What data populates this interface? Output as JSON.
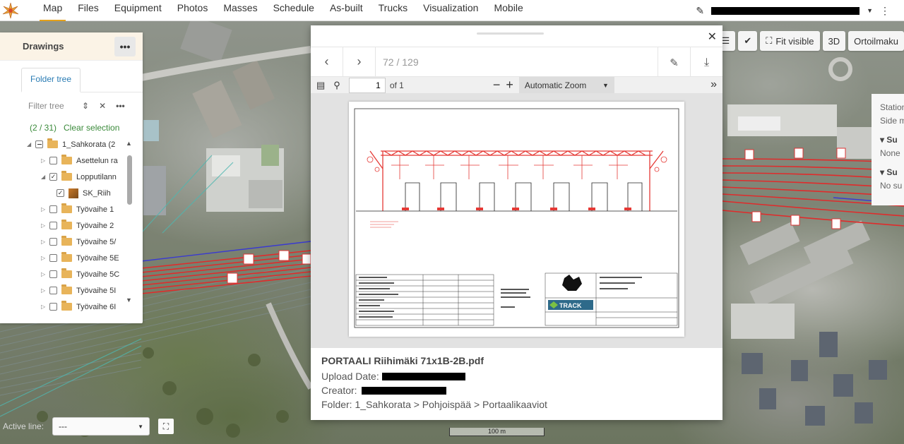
{
  "nav": {
    "items": [
      "Map",
      "Files",
      "Equipment",
      "Photos",
      "Masses",
      "Schedule",
      "As-built",
      "Trucks",
      "Visualization",
      "Mobile"
    ],
    "active": "Map"
  },
  "drawings": {
    "title": "Drawings",
    "more": "•••",
    "tab": "Folder tree",
    "filter_placeholder": "Filter tree",
    "selection_count": "(2 / 31)",
    "clear_selection": "Clear selection",
    "tree": [
      {
        "label": "1_Sahkorata (2",
        "state": "partial",
        "expanded": true
      },
      {
        "label": "Asettelun ra",
        "state": "unchecked"
      },
      {
        "label": "Lopputilann",
        "state": "checked",
        "expanded": true
      },
      {
        "label": "SK_Riih",
        "state": "checked",
        "type": "dwg"
      },
      {
        "label": "Työvaihe 1",
        "state": "unchecked"
      },
      {
        "label": "Työvaihe 2",
        "state": "unchecked"
      },
      {
        "label": "Työvaihe 5/",
        "state": "unchecked"
      },
      {
        "label": "Työvaihe 5E",
        "state": "unchecked"
      },
      {
        "label": "Työvaihe 5C",
        "state": "unchecked"
      },
      {
        "label": "Työvaihe 5I",
        "state": "unchecked"
      },
      {
        "label": "Työvaihe 6I",
        "state": "unchecked"
      }
    ]
  },
  "viewer": {
    "page_counter": "72 / 129",
    "page_number": "1",
    "of_pages": "of 1",
    "zoom": "Automatic Zoom",
    "file_name": "PORTAALI Riihimäki 71x1B-2B.pdf",
    "upload_label": "Upload Date:",
    "creator_label": "Creator:",
    "folder": "Folder: 1_Sahkorata > Pohjoispää > Portaalikaaviot",
    "drawing_brand": "TRACK"
  },
  "right_tools": {
    "fit_visible": "Fit visible",
    "three_d": "3D",
    "ortho": "Ortoilmaku"
  },
  "station_panel": {
    "lines": [
      "Station",
      "Side m"
    ],
    "sections": [
      {
        "title": "Su",
        "value": "None"
      },
      {
        "title": "Su",
        "value": "No su"
      }
    ]
  },
  "bottom": {
    "active_line_label": "Active line:",
    "active_line_value": "---",
    "scale_label": "100 m"
  },
  "colors": {
    "accent": "#e4a11b",
    "link": "#2a7cb4",
    "green": "#3a8a3a",
    "drawing_red": "#e53935"
  }
}
